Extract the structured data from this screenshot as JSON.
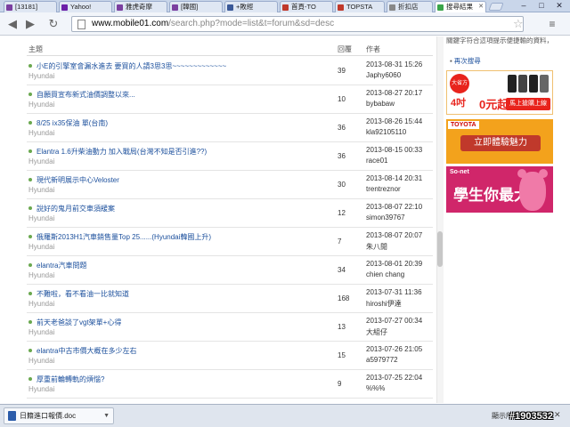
{
  "tabs": [
    {
      "label": "[13181]",
      "color": "#7b3fa0"
    },
    {
      "label": "Yahoo!",
      "color": "#6b1fa8"
    },
    {
      "label": "雅虎奇摩",
      "color": "#7b3fa0"
    },
    {
      "label": "[韓國]",
      "color": "#7b3fa0"
    },
    {
      "label": "+敗經",
      "color": "#3b5998"
    },
    {
      "label": "首頁-TO",
      "color": "#c0392b"
    },
    {
      "label": "TOPSTA",
      "color": "#c0392b"
    },
    {
      "label": "折扣店",
      "color": "#888888"
    },
    {
      "label": "搜尋結果",
      "color": "#3aa54a"
    }
  ],
  "window": {
    "minimize": "–",
    "maximize": "□",
    "close": "✕"
  },
  "toolbar": {
    "url_host": "www.mobile01.com",
    "url_path": "/search.php?mode=list&t=forum&sd=desc",
    "back": "◀",
    "forward": "▶",
    "reload": "↻",
    "star": "☆",
    "wrench": "≡"
  },
  "table": {
    "col_title": "主題",
    "col_replies": "回覆",
    "col_author": "作者",
    "rows": [
      {
        "title": "小E的引擎室會漏水進去 要買的人請3思3思~~~~~~~~~~~~~",
        "forum": "Hyundai",
        "replies": "39",
        "date": "2013-08-31 15:26",
        "author": "Japhy6060"
      },
      {
        "title": "自願買宣布新式油價調整以來...",
        "forum": "Hyundai",
        "replies": "10",
        "date": "2013-08-27 20:17",
        "author": "bybabaw"
      },
      {
        "title": "8/25 ix35保油 單(台南)",
        "forum": "Hyundai",
        "replies": "36",
        "date": "2013-08-26 15:44",
        "author": "kla92105110"
      },
      {
        "title": "Elantra 1.6升柴油動力 加入戰局(台灣不知是否引進??)",
        "forum": "Hyundai",
        "replies": "36",
        "date": "2013-08-15 00:33",
        "author": "race01"
      },
      {
        "title": "現代新明展示中心Veloster",
        "forum": "Hyundai",
        "replies": "30",
        "date": "2013-08-14 20:31",
        "author": "trentreznor"
      },
      {
        "title": "說好的鬼月前交車須緩案",
        "forum": "Hyundai",
        "replies": "12",
        "date": "2013-08-07 22:10",
        "author": "simon39767"
      },
      {
        "title": "俄羅斯2013H1汽車銷售量Top 25......(Hyundai韓國上升)",
        "forum": "Hyundai",
        "replies": "7",
        "date": "2013-08-07 20:07",
        "author": "朱八閒"
      },
      {
        "title": "elantra汽車問題",
        "forum": "Hyundai",
        "replies": "34",
        "date": "2013-08-01 20:39",
        "author": "chien chang"
      },
      {
        "title": "不難啦，看不看油一比就知道",
        "forum": "Hyundai",
        "replies": "168",
        "date": "2013-07-31 11:36",
        "author": "hiroshi伊達"
      },
      {
        "title": "前天老爸談了vgt架單+心得",
        "forum": "Hyundai",
        "replies": "13",
        "date": "2013-07-27 00:34",
        "author": "大組仔"
      },
      {
        "title": "elantra中古市價大概在多少左右",
        "forum": "Hyundai",
        "replies": "15",
        "date": "2013-07-26 21:05",
        "author": "a5979772"
      },
      {
        "title": "厚重前輪轉軌的煩惱?",
        "forum": "Hyundai",
        "replies": "9",
        "date": "2013-07-25 22:04",
        "author": "%%%"
      }
    ]
  },
  "sidebar": {
    "note": "關鍵字符合這項提示便捷輸的資料，",
    "again_link": "再次搜尋"
  },
  "ads": {
    "ad1_badge": "大省方案",
    "ad1_big": "4吋",
    "ad1_zero": "0元起",
    "ad1_btn": "馬上搶購上線",
    "ad2_brand": "TOYOTA",
    "ad2_btn": "立即體驗魅力",
    "ad3_brand": "So-net",
    "ad3_big": "學生你最大"
  },
  "downloads": {
    "file_name": "日籍進口報價.doc",
    "show_all": "顯示所有下載...",
    "close": "✕"
  },
  "watermark": "#1903532"
}
